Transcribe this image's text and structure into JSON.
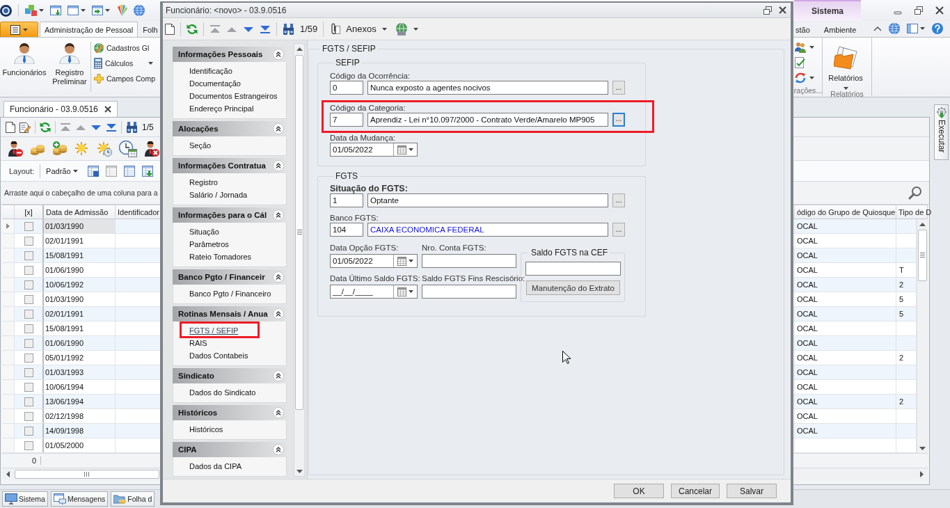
{
  "app": {
    "context_tab": "Sistema",
    "ribbon": {
      "tabs_left": [
        {
          "label": "Administração de Pessoal",
          "selected": true
        },
        {
          "label": "Folh",
          "selected": false
        }
      ],
      "tabs_right": [
        {
          "label": "stão",
          "selected": false
        },
        {
          "label": "Ambiente",
          "selected": false
        }
      ],
      "large_buttons": [
        "Funcionários",
        "Registro Preliminar"
      ],
      "small_buttons": [
        {
          "label": "Cadastros Gl",
          "dropdown": false
        },
        {
          "label": "Cálculos",
          "dropdown": true
        },
        {
          "label": "Campos Comp",
          "dropdown": false
        }
      ],
      "right_group_label": "rações...",
      "reports_button": "Relatórios",
      "reports_group_label": "Relatórios"
    },
    "document_tab": "Funcionário - 03.9.0516",
    "toolbar": {
      "record_position": "1/5"
    },
    "layout_bar": {
      "label": "Layout:",
      "layout": "Padrão"
    },
    "group_panel_hint": "Arraste aqui o cabeçalho de uma coluna para a",
    "grid": {
      "columns": [
        "[x]",
        "Data de Admissão",
        "Identificador",
        "ódigo do Grupo de Quiosque",
        "Tipo de D"
      ],
      "rows": [
        {
          "selected": true,
          "checked": false,
          "admission_date": "01/03/1990",
          "kiosk_group": "OCAL"
        },
        {
          "selected": false,
          "checked": false,
          "admission_date": "02/01/1991",
          "kiosk_group": "OCAL"
        },
        {
          "selected": false,
          "checked": false,
          "admission_date": "15/08/1991",
          "kiosk_group": "OCAL"
        },
        {
          "selected": false,
          "checked": false,
          "admission_date": "01/06/1990",
          "kiosk_group": "OCAL",
          "type": "T"
        },
        {
          "selected": false,
          "checked": false,
          "admission_date": "10/06/1992",
          "kiosk_group": "OCAL",
          "type": "2"
        },
        {
          "selected": false,
          "checked": false,
          "admission_date": "01/03/1990",
          "kiosk_group": "OCAL",
          "type": "5"
        },
        {
          "selected": false,
          "checked": false,
          "admission_date": "02/01/1991",
          "kiosk_group": "OCAL",
          "type": "5"
        },
        {
          "selected": false,
          "checked": false,
          "admission_date": "15/08/1991",
          "kiosk_group": "OCAL"
        },
        {
          "selected": false,
          "checked": false,
          "admission_date": "01/06/1990",
          "kiosk_group": "OCAL"
        },
        {
          "selected": false,
          "checked": false,
          "admission_date": "05/01/1992",
          "kiosk_group": "OCAL",
          "type": "2"
        },
        {
          "selected": false,
          "checked": false,
          "admission_date": "01/03/1993",
          "kiosk_group": "OCAL"
        },
        {
          "selected": false,
          "checked": false,
          "admission_date": "10/06/1994",
          "kiosk_group": "OCAL"
        },
        {
          "selected": false,
          "checked": false,
          "admission_date": "13/06/1994",
          "kiosk_group": "OCAL",
          "type": "2"
        },
        {
          "selected": false,
          "checked": false,
          "admission_date": "02/12/1998",
          "kiosk_group": "OCAL"
        },
        {
          "selected": false,
          "checked": false,
          "admission_date": "14/09/1998",
          "kiosk_group": "OCAL"
        },
        {
          "selected": false,
          "checked": false,
          "admission_date": "01/05/2000"
        }
      ],
      "footer": "0"
    },
    "side_tab": "Executar",
    "taskbar": [
      "Sistema",
      "Mensagens",
      "Folha d"
    ]
  },
  "dialog": {
    "title": "Funcionário: <novo> - 03.9.0516",
    "toolbar": {
      "record_position": "1/59",
      "attachments": "Anexos"
    },
    "nav": [
      {
        "title": "Informações Pessoais",
        "expanded": true,
        "items": [
          {
            "label": "Identificação",
            "selected": false,
            "highlighted": false
          },
          {
            "label": "Documentação",
            "selected": false,
            "highlighted": false
          },
          {
            "label": "Documentos Estrangeiros",
            "selected": false,
            "highlighted": false
          },
          {
            "label": "Endereço Principal",
            "selected": false,
            "highlighted": false
          }
        ]
      },
      {
        "title": "Alocações",
        "expanded": true,
        "items": [
          {
            "label": "Seção",
            "selected": false,
            "highlighted": false
          }
        ]
      },
      {
        "title": "Informações Contratua",
        "expanded": true,
        "items": [
          {
            "label": "Registro",
            "selected": false,
            "highlighted": false
          },
          {
            "label": "Salário / Jornada",
            "selected": false,
            "highlighted": false
          }
        ]
      },
      {
        "title": "Informações para o Cál",
        "expanded": true,
        "items": [
          {
            "label": "Situação",
            "selected": false,
            "highlighted": false
          },
          {
            "label": "Parâmetros",
            "selected": false,
            "highlighted": false
          },
          {
            "label": "Rateio Tomadores",
            "selected": false,
            "highlighted": false
          }
        ]
      },
      {
        "title": "Banco Pgto / Financeir",
        "expanded": true,
        "items": [
          {
            "label": "Banco Pgto / Financeiro",
            "selected": false,
            "highlighted": false
          }
        ]
      },
      {
        "title": "Rotinas Mensais / Anua",
        "expanded": true,
        "items": [
          {
            "label": "FGTS / SEFIP",
            "selected": true,
            "highlighted": true
          },
          {
            "label": "RAIS",
            "selected": false,
            "highlighted": false
          },
          {
            "label": "Dados Contabeis",
            "selected": false,
            "highlighted": false
          }
        ]
      },
      {
        "title": "Sindicato",
        "expanded": true,
        "items": [
          {
            "label": "Dados do Sindicato",
            "selected": false,
            "highlighted": false
          }
        ]
      },
      {
        "title": "Históricos",
        "expanded": true,
        "items": [
          {
            "label": "Históricos",
            "selected": false,
            "highlighted": false
          }
        ]
      },
      {
        "title": "CIPA",
        "expanded": true,
        "items": [
          {
            "label": "Dados da CIPA",
            "selected": false,
            "highlighted": false
          }
        ]
      }
    ],
    "content": {
      "title": "FGTS / SEFIP",
      "sefip": {
        "title": "SEFIP",
        "lookups": [
          {
            "label": "Código da Ocorrência:",
            "code": "0",
            "description": "Nunca exposto a agentes nocivos",
            "button": "...",
            "required": false,
            "linked": false,
            "focused": false,
            "highlighted": false
          },
          {
            "label": "Código da Categoria:",
            "code": "7",
            "description": "Aprendiz - Lei n°10.097/2000 - Contrato Verde/Amarelo MP905",
            "button": "...",
            "required": false,
            "linked": false,
            "focused": true,
            "highlighted": true
          }
        ],
        "change_date": {
          "label": "Data da Mudança:",
          "value": "01/05/2022"
        }
      },
      "fgts": {
        "title": "FGTS",
        "lookups": [
          {
            "label": "Situação do FGTS:",
            "code": "1",
            "description": "Optante",
            "button": "...",
            "required": true,
            "linked": false,
            "focused": false,
            "highlighted": false
          },
          {
            "label": "Banco FGTS:",
            "code": "104",
            "description": "CAIXA ECONOMICA FEDERAL",
            "button": "...",
            "required": false,
            "linked": true,
            "focused": false,
            "highlighted": false
          }
        ],
        "option_date": {
          "label": "Data Opção FGTS:",
          "value": "01/05/2022"
        },
        "account": {
          "label": "Nro. Conta FGTS:"
        },
        "last_balance_date": {
          "label": "Data Último Saldo FGTS:",
          "value": "__/__/____"
        },
        "rescission_balance": {
          "label": "Saldo FGTS Fins Rescisório:"
        },
        "cef_balance": {
          "title": "Saldo FGTS na CEF",
          "button": "Manutenção do Extrato"
        }
      }
    },
    "buttons": [
      "OK",
      "Cancelar",
      "Salvar"
    ]
  }
}
